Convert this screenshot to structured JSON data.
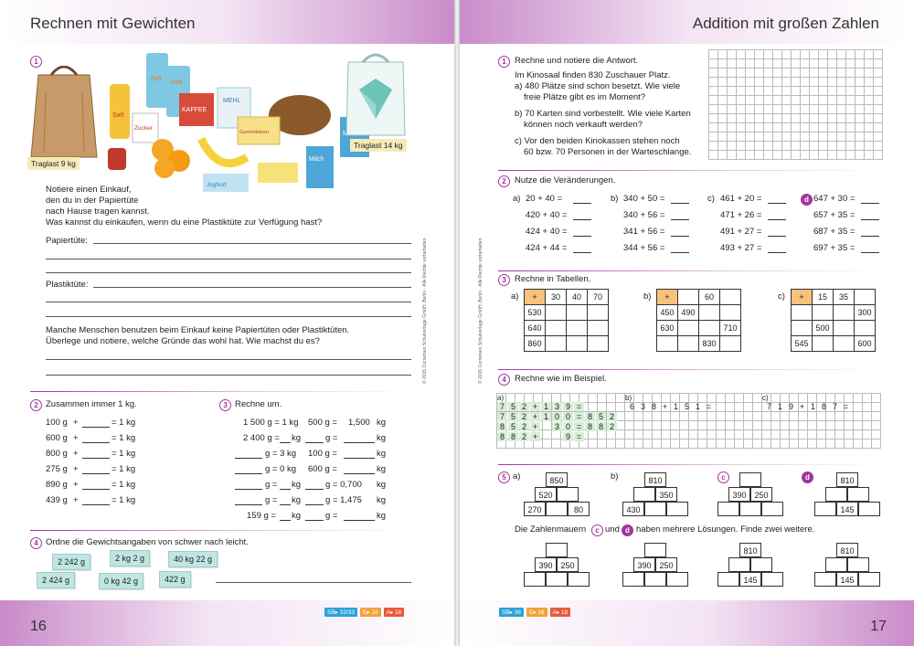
{
  "left": {
    "title": "Rechnen mit Gewichten",
    "page_number": "16",
    "badges": [
      "SB▸ 32/33",
      "E▸ 16",
      "A▸ 16"
    ],
    "copyright": "© 2015 Cornelsen Schulverlage GmbH, Berlin · Alle Rechte vorbehalten.",
    "t1": {
      "num": "1",
      "bag_label": "Traglast 9 kg",
      "plastic_label": "Traglast 14 kg",
      "food_labels": [
        "Saft",
        "Saft",
        "Zucker",
        "Saft",
        "KAFFEE",
        "MEHL",
        "Gummibären",
        "Milch",
        "Milch",
        "Joghurt"
      ],
      "text1": "Notiere einen Einkauf,",
      "text2": "den du in der Papiertüte",
      "text3": "nach Hause tragen kannst.",
      "text4": "Was kannst du einkaufen, wenn du eine Plastiktüte zur Verfügung hast?",
      "paper_label": "Papiertüte:",
      "plastic_field_label": "Plastiktüte:",
      "text5": "Manche Menschen benutzen beim Einkauf keine Papiertüten oder Plastiktüten.",
      "text6": "Überlege und notiere, welche Gründe das wohl hat. Wie machst du es?"
    },
    "t2": {
      "num": "2",
      "title": "Zusammen immer 1 kg.",
      "rows": [
        "100 g",
        "600 g",
        "800 g",
        "275 g",
        "890 g",
        "439 g"
      ],
      "plus": "+",
      "result": "= 1 kg"
    },
    "t3": {
      "num": "3",
      "title": "Rechne um.",
      "rows": [
        [
          "1 500 g = 1 kg",
          "500 g =",
          "1,500",
          "kg"
        ],
        [
          "2 400 g =",
          "kg",
          "g =",
          "kg"
        ],
        [
          "g = 3 kg",
          "100 g =",
          "",
          "kg"
        ],
        [
          "g = 0 kg",
          "600 g =",
          "",
          "kg"
        ],
        [
          "g =",
          "kg",
          "g = 0,700",
          "kg"
        ],
        [
          "g =",
          "kg",
          "g = 1,475",
          "kg"
        ],
        [
          "159 g =",
          "kg",
          "g =",
          "kg"
        ]
      ]
    },
    "t4": {
      "num": "4",
      "title": "Ordne die Gewichtsangaben von schwer nach leicht.",
      "cards": [
        "2 242 g",
        "2 kg 2 g",
        "40 kg 22 g",
        "2 424 g",
        "0 kg 42 g",
        "422 g"
      ]
    }
  },
  "right": {
    "title": "Addition mit großen Zahlen",
    "page_number": "17",
    "badges": [
      "SB▸ 36",
      "E▸ 18",
      "A▸ 18"
    ],
    "copyright": "© 2015 Cornelsen Schulverlage GmbH, Berlin · Alle Rechte vorbehalten.",
    "t1": {
      "num": "1",
      "title": "Rechne und notiere die Antwort.",
      "intro": "Im Kinosaal finden 830 Zuschauer Platz.",
      "a1": "a) 480 Plätze sind schon besetzt. Wie viele",
      "a2": "freie Plätze gibt es im Moment?",
      "b1": "b) 70 Karten sind vorbestellt. Wie viele Karten",
      "b2": "können noch verkauft werden?",
      "c1": "c) Vor den beiden Kinokassen stehen noch",
      "c2": "60 bzw. 70 Personen in der Warteschlange."
    },
    "t2": {
      "num": "2",
      "title": "Nutze die Veränderungen.",
      "cols": [
        {
          "label": "a)",
          "rows": [
            "20 + 40 =",
            "420 + 40 =",
            "424 + 40 =",
            "424 + 44 ="
          ]
        },
        {
          "label": "b)",
          "rows": [
            "340 + 50 =",
            "340 + 56 =",
            "341 + 56 =",
            "344 + 56 ="
          ]
        },
        {
          "label": "c)",
          "rows": [
            "461 + 20 =",
            "471 + 26 =",
            "491 + 27 =",
            "493 + 27 ="
          ]
        },
        {
          "label": "d",
          "rows": [
            "647 + 30 =",
            "657 + 35 =",
            "687 + 35 =",
            "697 + 35 ="
          ]
        }
      ]
    },
    "t3": {
      "num": "3",
      "title": "Rechne in Tabellen.",
      "tables": [
        {
          "label": "a)",
          "cells": [
            [
              "+",
              "30",
              "40",
              "70"
            ],
            [
              "530",
              "",
              "",
              ""
            ],
            [
              "640",
              "",
              "",
              ""
            ],
            [
              "860",
              "",
              "",
              ""
            ]
          ]
        },
        {
          "label": "b)",
          "cells": [
            [
              "+",
              "",
              "60",
              ""
            ],
            [
              "450",
              "490",
              "",
              ""
            ],
            [
              "630",
              "",
              "",
              "710"
            ],
            [
              "",
              "",
              "830",
              ""
            ]
          ]
        },
        {
          "label": "c)",
          "cells": [
            [
              "+",
              "15",
              "35",
              ""
            ],
            [
              "",
              "",
              "",
              "300"
            ],
            [
              "",
              "500",
              "",
              ""
            ],
            [
              "545",
              "",
              "",
              "600"
            ]
          ]
        }
      ]
    },
    "t4": {
      "num": "4",
      "title": "Rechne wie im Beispiel.",
      "a_label": "a)",
      "b_label": "b)",
      "c_label": "c)",
      "a_rows": [
        [
          "7",
          "5",
          "2",
          "+",
          "1",
          "3",
          "9",
          "=",
          "",
          "",
          ""
        ],
        [
          "7",
          "5",
          "2",
          "+",
          "1",
          "0",
          "0",
          "=",
          "8",
          "5",
          "2"
        ],
        [
          "8",
          "5",
          "2",
          "+",
          "",
          "3",
          "0",
          "=",
          "8",
          "8",
          "2"
        ],
        [
          "8",
          "8",
          "2",
          "+",
          "",
          "",
          "9",
          "=",
          "",
          "",
          ""
        ]
      ],
      "b_row": [
        "6",
        "3",
        "8",
        "+",
        "1",
        "5",
        "1",
        "="
      ],
      "c_row": [
        "7",
        "1",
        "9",
        "+",
        "1",
        "8",
        "7",
        "="
      ]
    },
    "t5": {
      "num": "5",
      "labels": [
        "a)",
        "b)",
        "c",
        "d"
      ],
      "pyramids": [
        {
          "top": "850",
          "mid": [
            "520",
            ""
          ],
          "bot": [
            "270",
            "",
            "80"
          ]
        },
        {
          "top": "810",
          "mid": [
            "",
            "350"
          ],
          "bot": [
            "430",
            "",
            ""
          ]
        },
        {
          "top": "",
          "mid": [
            "390",
            "250"
          ],
          "bot": [
            "",
            "",
            ""
          ]
        },
        {
          "top": "810",
          "mid": [
            "",
            ""
          ],
          "bot": [
            "",
            "145",
            ""
          ]
        }
      ],
      "text_a": "Die Zahlenmauern",
      "text_c": "c",
      "text_mid": "und",
      "text_d": "d",
      "text_b": "haben mehrere Lösungen. Finde zwei weitere.",
      "pyramids2": [
        {
          "top": "",
          "mid": [
            "390",
            "250"
          ],
          "bot": [
            "",
            "",
            ""
          ]
        },
        {
          "top": "",
          "mid": [
            "390",
            "250"
          ],
          "bot": [
            "",
            "",
            ""
          ]
        },
        {
          "top": "810",
          "mid": [
            "",
            ""
          ],
          "bot": [
            "",
            "145",
            ""
          ]
        },
        {
          "top": "810",
          "mid": [
            "",
            ""
          ],
          "bot": [
            "",
            "145",
            ""
          ]
        }
      ]
    }
  },
  "colors": {
    "accent": "#a2359e",
    "header": "#c98bc9",
    "label_bg": "#f4ecb8",
    "card": "#bfe6e3",
    "table_op": "#f7c27a",
    "grid_green": "#d8eed6"
  }
}
